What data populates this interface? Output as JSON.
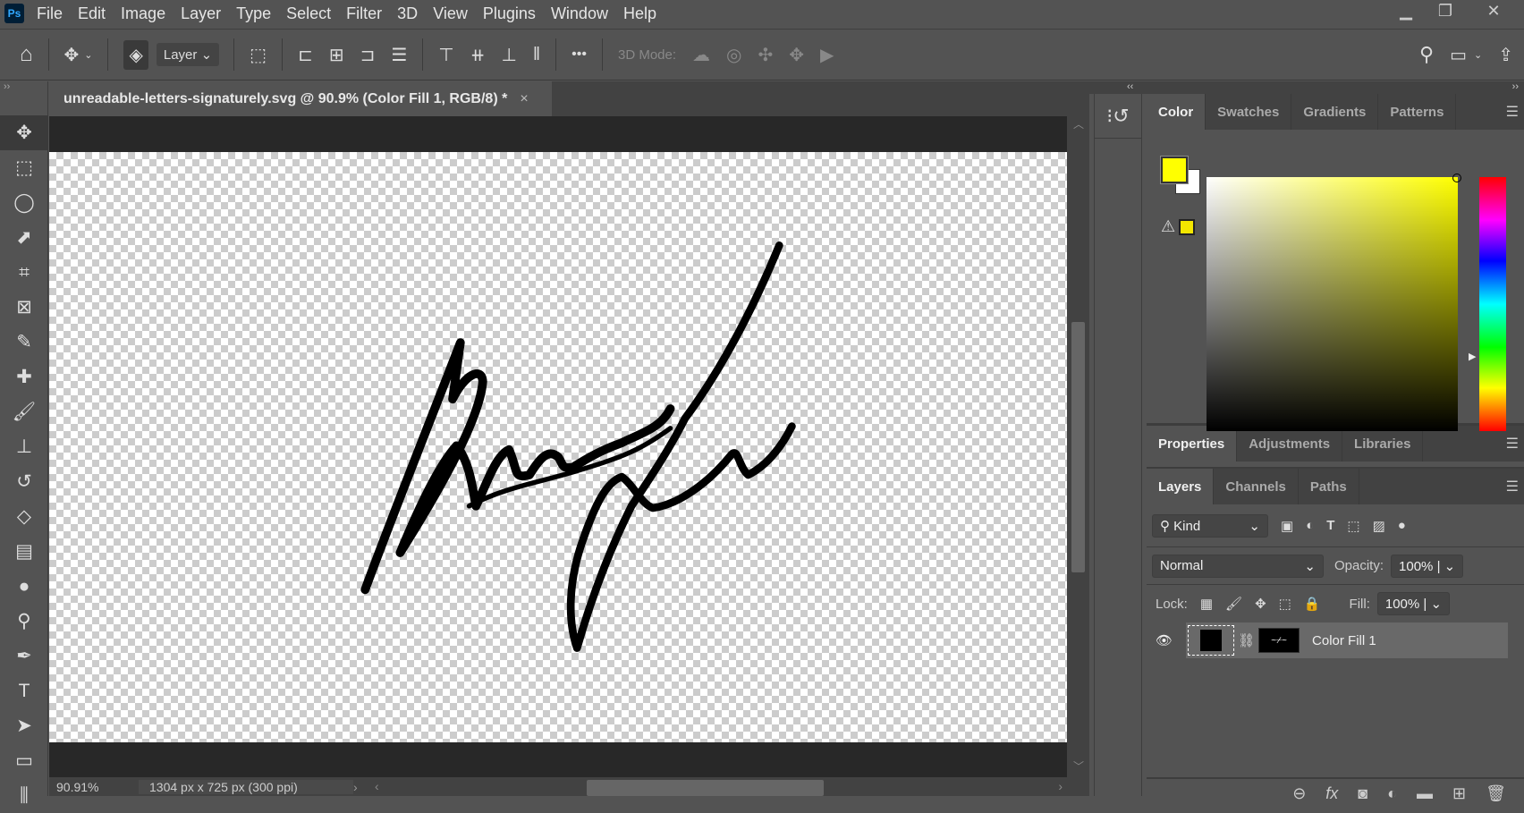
{
  "app": {
    "logo": "Ps",
    "menu": [
      "File",
      "Edit",
      "Image",
      "Layer",
      "Type",
      "Select",
      "Filter",
      "3D",
      "View",
      "Plugins",
      "Window",
      "Help"
    ],
    "window_controls": [
      "minimize",
      "restore",
      "close"
    ]
  },
  "options": {
    "auto_select_target": "Layer",
    "three_d_mode_label": "3D Mode:",
    "more": "•••"
  },
  "document": {
    "tab_title": "unreadable-letters-signaturely.svg @ 90.9% (Color Fill 1, RGB/8) *",
    "close": "×"
  },
  "status": {
    "zoom": "90.91%",
    "doc_info": "1304 px x 725 px (300 ppi)"
  },
  "color_panel": {
    "tabs": [
      "Color",
      "Swatches",
      "Gradients",
      "Patterns"
    ],
    "foreground": "#ffff00",
    "background": "#ffffff",
    "gamut_warning_color": "#f3e600",
    "hue": "#ffff00"
  },
  "properties_panel": {
    "tabs": [
      "Properties",
      "Adjustments",
      "Libraries"
    ]
  },
  "layers_panel": {
    "tabs": [
      "Layers",
      "Channels",
      "Paths"
    ],
    "filter_kind": "Kind",
    "blend_mode": "Normal",
    "opacity_label": "Opacity:",
    "opacity": "100%",
    "lock_label": "Lock:",
    "fill_label": "Fill:",
    "fill": "100%",
    "layers": [
      {
        "name": "Color Fill 1",
        "visible": true,
        "fill_color": "#000000"
      }
    ]
  },
  "colors": {
    "accent": "#31a8ff",
    "panel": "#535353",
    "workspace": "#282828"
  }
}
